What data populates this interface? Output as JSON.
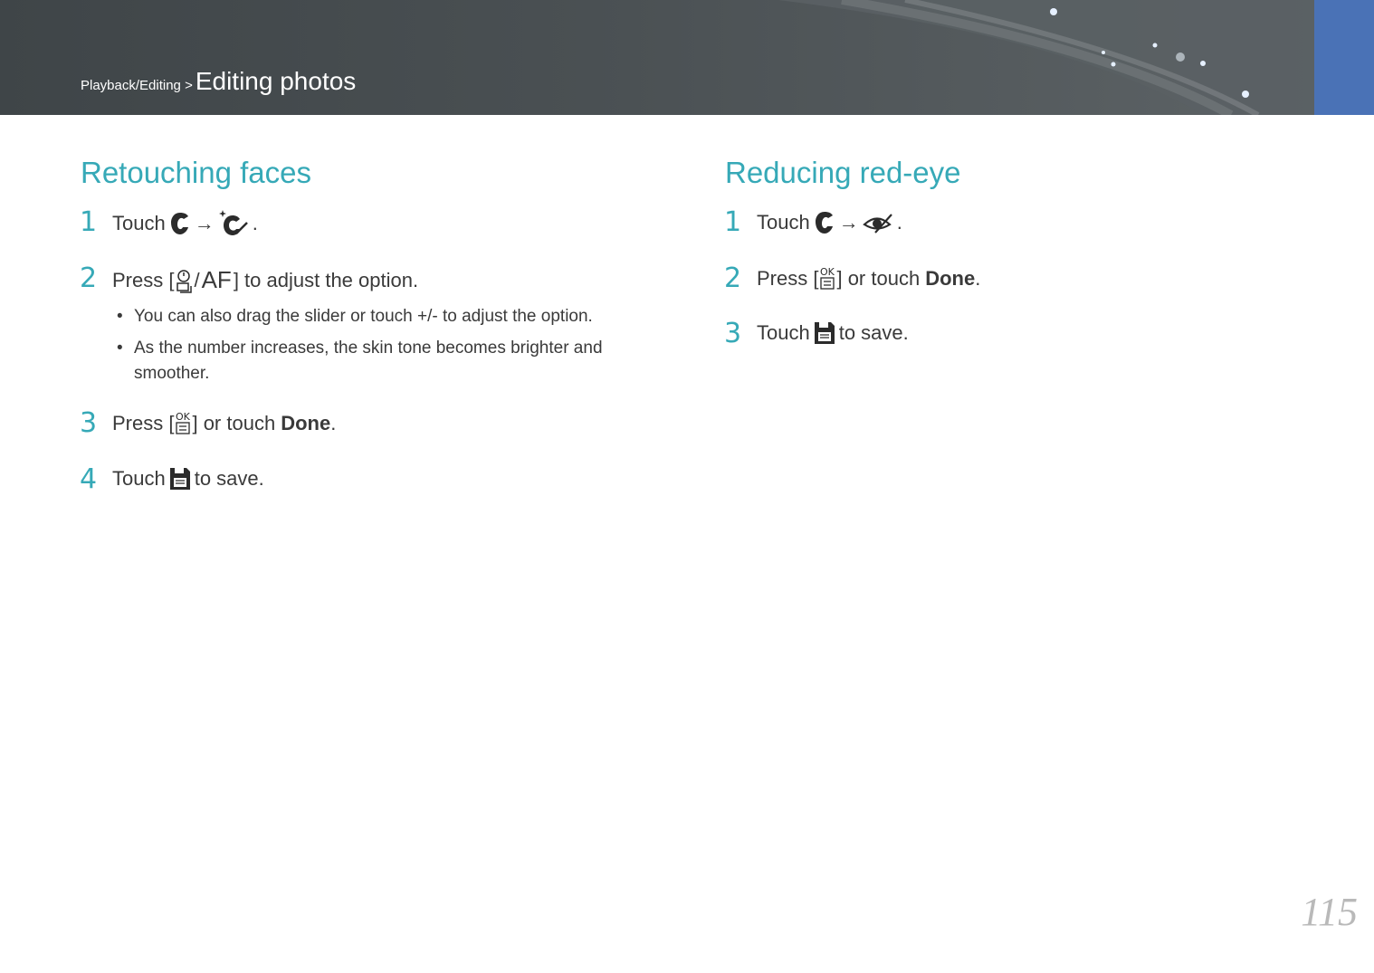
{
  "header": {
    "breadcrumb_parent": "Playback/Editing >",
    "breadcrumb_current": "Editing photos"
  },
  "left": {
    "title": "Retouching faces",
    "steps": [
      {
        "num": "1",
        "text_before": "Touch",
        "arrow": "→",
        "text_after": "."
      },
      {
        "num": "2",
        "text_before": "Press [",
        "separator": "/",
        "af": "AF",
        "text_after": "] to adjust the option."
      },
      {
        "num": "3",
        "text_before": "Press [",
        "text_middle": "] or touch",
        "bold": "Done",
        "text_after": "."
      },
      {
        "num": "4",
        "text_before": "Touch",
        "text_after": "to save."
      }
    ],
    "bullets": [
      "You can also drag the slider or touch +/- to adjust the option.",
      "As the number increases, the skin tone becomes brighter and smoother."
    ]
  },
  "right": {
    "title": "Reducing red-eye",
    "steps": [
      {
        "num": "1",
        "text_before": "Touch",
        "arrow": "→",
        "text_after": "."
      },
      {
        "num": "2",
        "text_before": "Press [",
        "text_middle": "] or touch",
        "bold": "Done",
        "text_after": "."
      },
      {
        "num": "3",
        "text_before": "Touch",
        "text_after": "to save."
      }
    ]
  },
  "page_number": "115",
  "icons": {
    "edit": "edit-face-icon",
    "face_retouch": "face-retouch-icon",
    "red_eye": "red-eye-icon",
    "timer": "self-timer-icon",
    "ok": "ok-button-icon",
    "save": "save-icon"
  },
  "colors": {
    "accent": "#36a9b7",
    "header_tab": "#4a72b6",
    "header_bg": "#4a5053"
  }
}
